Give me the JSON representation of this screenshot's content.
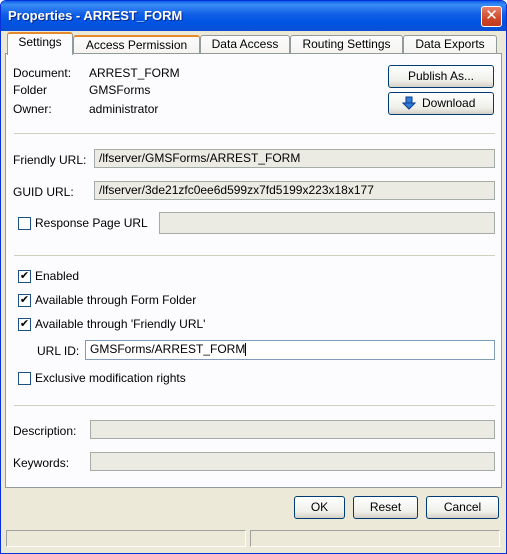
{
  "window": {
    "title": "Properties - ARREST_FORM",
    "close_glyph": "✕"
  },
  "tabs": [
    {
      "label": "Settings"
    },
    {
      "label": "Access Permission"
    },
    {
      "label": "Data Access"
    },
    {
      "label": "Routing Settings"
    },
    {
      "label": "Data Exports"
    }
  ],
  "info": {
    "document_label": "Document:",
    "document_value": "ARREST_FORM",
    "folder_label": "Folder",
    "folder_value": "GMSForms",
    "owner_label": "Owner:",
    "owner_value": "administrator"
  },
  "buttons": {
    "publish_as": "Publish As...",
    "download": "Download",
    "ok": "OK",
    "reset": "Reset",
    "cancel": "Cancel"
  },
  "urls": {
    "friendly_label": "Friendly URL:",
    "friendly_value": "/lfserver/GMSForms/ARREST_FORM",
    "guid_label": "GUID URL:",
    "guid_value": "/lfserver/3de21zfc0ee6d599zx7fd5199x223x18x177",
    "response_label": "Response Page URL",
    "response_checked": false,
    "response_value": ""
  },
  "options": {
    "enabled_label": "Enabled",
    "enabled_checked": true,
    "folder_label": "Available through Form Folder",
    "folder_checked": true,
    "friendly_label": "Available through 'Friendly URL'",
    "friendly_checked": true,
    "url_id_label": "URL ID:",
    "url_id_value": "GMSForms/ARREST_FORM",
    "exclusive_label": "Exclusive modification rights",
    "exclusive_checked": false
  },
  "meta": {
    "description_label": "Description:",
    "description_value": "",
    "keywords_label": "Keywords:",
    "keywords_value": ""
  },
  "check_glyph": "✔",
  "colors": {
    "title_bar": "#0054e3",
    "tab_hot": "#e68b2c",
    "window_bg": "#ece9d8"
  }
}
